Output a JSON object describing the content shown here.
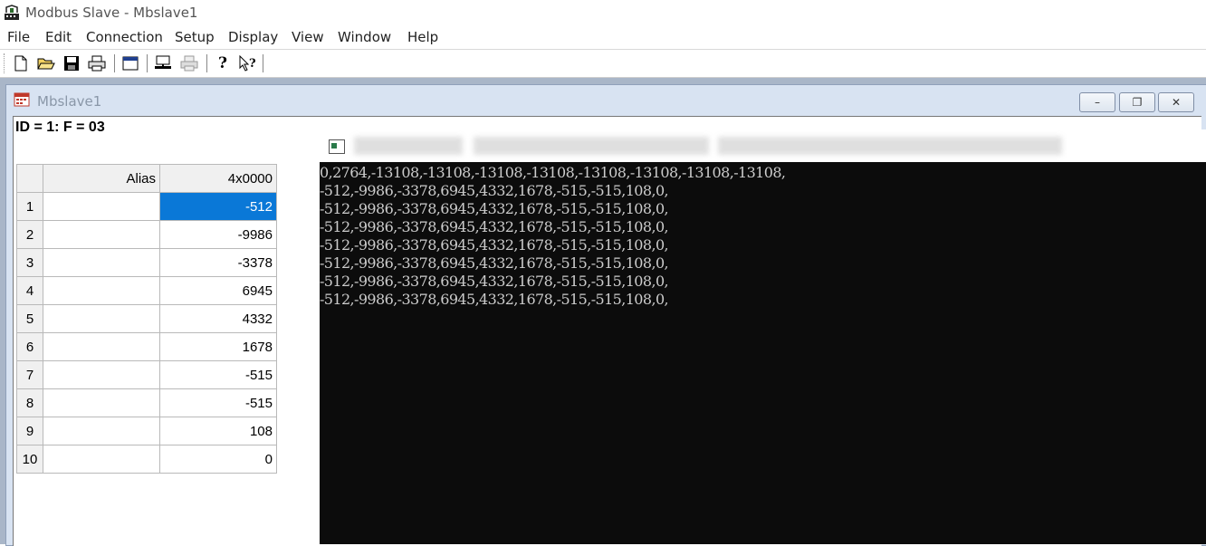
{
  "app": {
    "title": "Modbus Slave - Mbslave1"
  },
  "menu": {
    "items": [
      "File",
      "Edit",
      "Connection",
      "Setup",
      "Display",
      "View",
      "Window",
      "Help"
    ]
  },
  "toolbar": {
    "icons": [
      "new-icon",
      "open-icon",
      "save-icon",
      "print-icon",
      "window-icon",
      "connect-icon",
      "disconnect-icon",
      "help-icon",
      "context-help-icon"
    ]
  },
  "child_window": {
    "title": "Mbslave1",
    "status_line": "ID = 1: F = 03",
    "buttons": {
      "minimize": "–",
      "restore": "❐",
      "close": "✕"
    }
  },
  "register_table": {
    "headers": {
      "alias": "Alias",
      "address": "4x0000"
    },
    "rows": [
      {
        "index": "1",
        "alias": "",
        "value": "-512",
        "selected": true
      },
      {
        "index": "2",
        "alias": "",
        "value": "-9986"
      },
      {
        "index": "3",
        "alias": "",
        "value": "-3378"
      },
      {
        "index": "4",
        "alias": "",
        "value": "6945"
      },
      {
        "index": "5",
        "alias": "",
        "value": "4332"
      },
      {
        "index": "6",
        "alias": "",
        "value": "1678"
      },
      {
        "index": "7",
        "alias": "",
        "value": "-515"
      },
      {
        "index": "8",
        "alias": "",
        "value": "-515"
      },
      {
        "index": "9",
        "alias": "",
        "value": "108"
      },
      {
        "index": "10",
        "alias": "",
        "value": "0"
      }
    ],
    "selection_color": "#0a78d7"
  },
  "console": {
    "lines": [
      "0,2764,-13108,-13108,-13108,-13108,-13108,-13108,-13108,-13108,",
      "-512,-9986,-3378,6945,4332,1678,-515,-515,108,0,",
      "-512,-9986,-3378,6945,4332,1678,-515,-515,108,0,",
      "-512,-9986,-3378,6945,4332,1678,-515,-515,108,0,",
      "-512,-9986,-3378,6945,4332,1678,-515,-515,108,0,",
      "-512,-9986,-3378,6945,4332,1678,-515,-515,108,0,",
      "-512,-9986,-3378,6945,4332,1678,-515,-515,108,0,",
      "-512,-9986,-3378,6945,4332,1678,-515,-515,108,0,"
    ]
  }
}
